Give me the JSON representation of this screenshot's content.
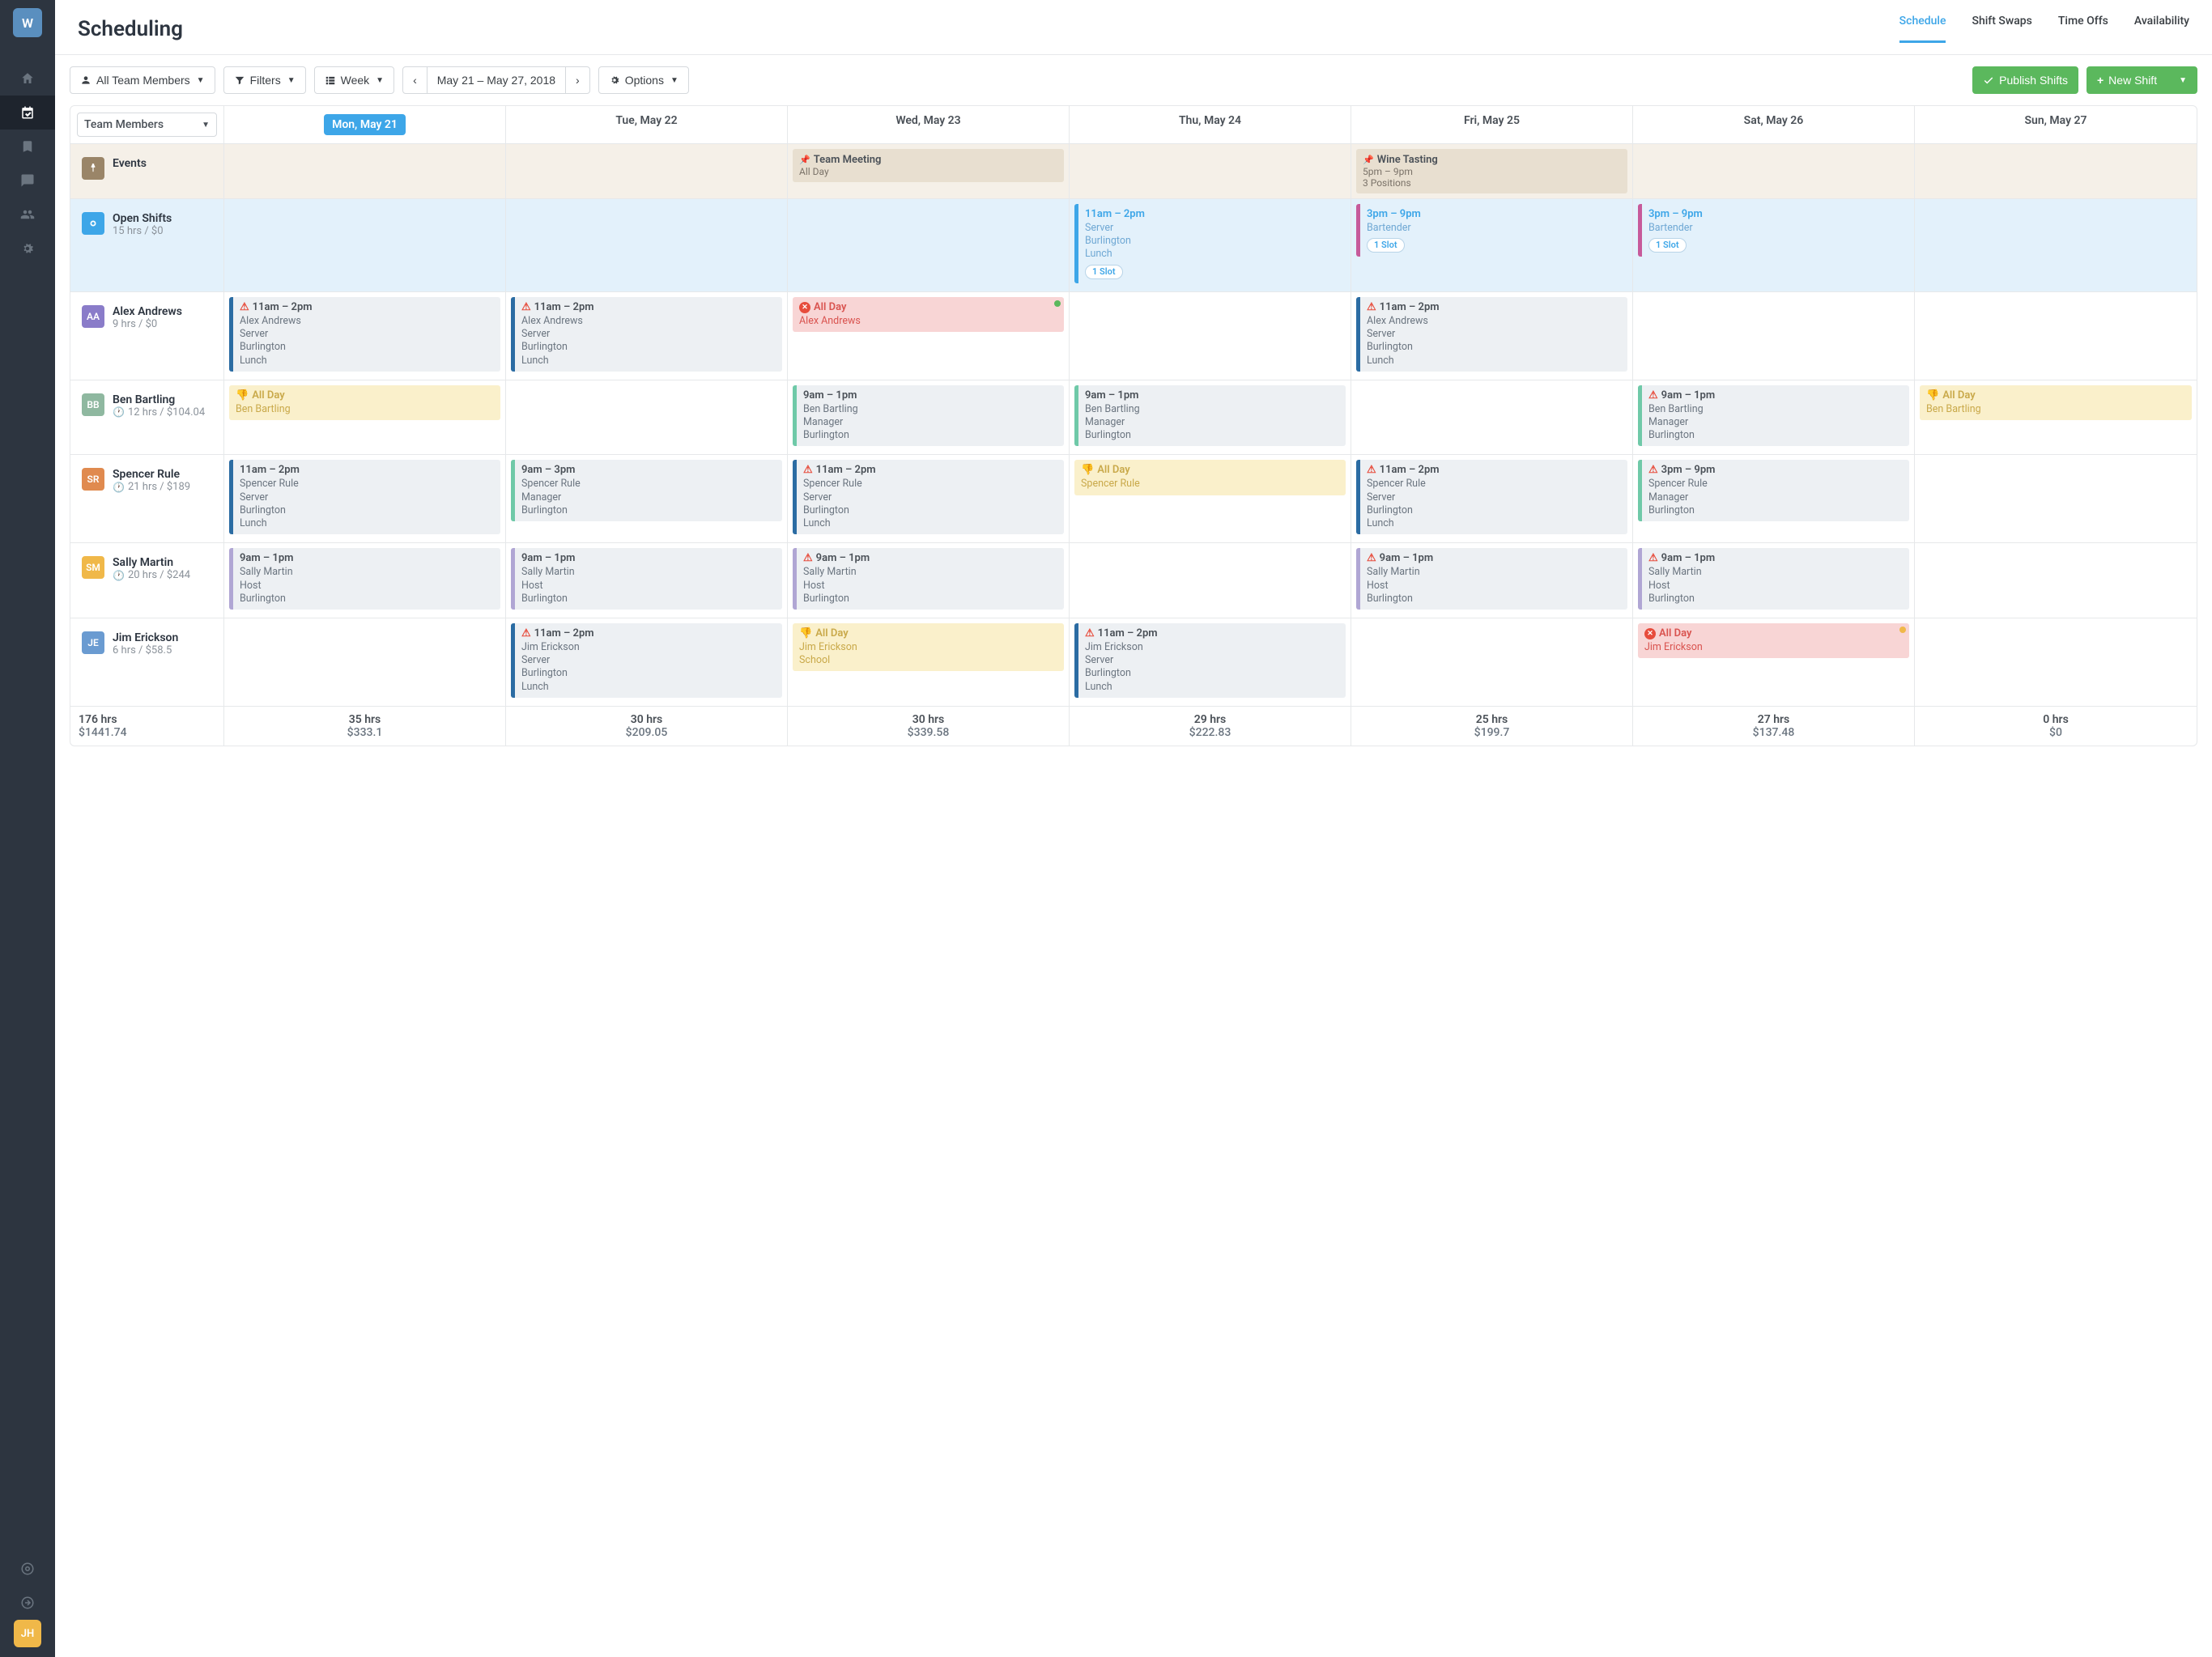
{
  "sidebar": {
    "logo": "W",
    "user_avatar": "JH"
  },
  "header": {
    "title": "Scheduling",
    "tabs": [
      {
        "label": "Schedule",
        "active": true
      },
      {
        "label": "Shift Swaps",
        "active": false
      },
      {
        "label": "Time Offs",
        "active": false
      },
      {
        "label": "Availability",
        "active": false
      }
    ]
  },
  "toolbar": {
    "team_filter": "All Team Members",
    "filters": "Filters",
    "view": "Week",
    "date_range": "May 21 – May 27, 2018",
    "options": "Options",
    "publish": "Publish Shifts",
    "new_shift": "New Shift"
  },
  "columns": {
    "selector": "Team Members",
    "days": [
      "Mon, May 21",
      "Tue, May 22",
      "Wed, May 23",
      "Thu, May 24",
      "Fri, May 25",
      "Sat, May 26",
      "Sun, May 27"
    ]
  },
  "events_row": {
    "label": "Events",
    "items": {
      "wed": {
        "title": "Team Meeting",
        "sub": "All Day"
      },
      "fri": {
        "title": "Wine Tasting",
        "sub1": "5pm – 9pm",
        "sub2": "3 Positions"
      }
    }
  },
  "open_shifts": {
    "label": "Open Shifts",
    "meta": "15 hrs / $0",
    "thu": {
      "time": "11am – 2pm",
      "role": "Server",
      "loc": "Burlington",
      "period": "Lunch",
      "slot": "1 Slot",
      "bar": "#3da6e8"
    },
    "fri": {
      "time": "3pm – 9pm",
      "role": "Bartender",
      "slot": "1 Slot",
      "bar": "#c75a9a"
    },
    "sat": {
      "time": "3pm – 9pm",
      "role": "Bartender",
      "slot": "1 Slot",
      "bar": "#c75a9a"
    }
  },
  "members": [
    {
      "initials": "AA",
      "color": "#8a7cc9",
      "name": "Alex Andrews",
      "meta": "9 hrs / $0",
      "clock": false,
      "shifts": {
        "mon": {
          "type": "std",
          "alert": true,
          "time": "11am – 2pm",
          "l1": "Alex Andrews",
          "l2": "Server",
          "l3": "Burlington",
          "l4": "Lunch",
          "bar": "#2b6ca3"
        },
        "tue": {
          "type": "std",
          "alert": true,
          "time": "11am – 2pm",
          "l1": "Alex Andrews",
          "l2": "Server",
          "l3": "Burlington",
          "l4": "Lunch",
          "bar": "#2b6ca3"
        },
        "wed": {
          "type": "red",
          "xicon": true,
          "time": "All Day",
          "l1": "Alex Andrews",
          "dot": "#5bb85d"
        },
        "fri": {
          "type": "std",
          "alert": true,
          "time": "11am – 2pm",
          "l1": "Alex Andrews",
          "l2": "Server",
          "l3": "Burlington",
          "l4": "Lunch",
          "bar": "#2b6ca3"
        }
      }
    },
    {
      "initials": "BB",
      "color": "#8fb8a0",
      "name": "Ben Bartling",
      "meta": "12 hrs / $104.04",
      "clock": true,
      "shifts": {
        "mon": {
          "type": "yellow",
          "thumb": true,
          "time": "All Day",
          "l1": "Ben Bartling"
        },
        "wed": {
          "type": "std",
          "time": "9am – 1pm",
          "l1": "Ben Bartling",
          "l2": "Manager",
          "l3": "Burlington",
          "bar": "#6fc9a8"
        },
        "thu": {
          "type": "std",
          "time": "9am – 1pm",
          "l1": "Ben Bartling",
          "l2": "Manager",
          "l3": "Burlington",
          "bar": "#6fc9a8"
        },
        "sat": {
          "type": "std",
          "alert": true,
          "time": "9am – 1pm",
          "l1": "Ben Bartling",
          "l2": "Manager",
          "l3": "Burlington",
          "bar": "#6fc9a8"
        },
        "sun": {
          "type": "yellow",
          "thumb": true,
          "time": "All Day",
          "l1": "Ben Bartling"
        }
      }
    },
    {
      "initials": "SR",
      "color": "#e08a4f",
      "name": "Spencer Rule",
      "meta": "21 hrs / $189",
      "clock": true,
      "shifts": {
        "mon": {
          "type": "std",
          "time": "11am – 2pm",
          "l1": "Spencer Rule",
          "l2": "Server",
          "l3": "Burlington",
          "l4": "Lunch",
          "bar": "#2b6ca3"
        },
        "tue": {
          "type": "std",
          "time": "9am – 3pm",
          "l1": "Spencer Rule",
          "l2": "Manager",
          "l3": "Burlington",
          "bar": "#6fc9a8"
        },
        "wed": {
          "type": "std",
          "alert": true,
          "time": "11am – 2pm",
          "l1": "Spencer Rule",
          "l2": "Server",
          "l3": "Burlington",
          "l4": "Lunch",
          "bar": "#2b6ca3"
        },
        "thu": {
          "type": "yellow",
          "thumb": true,
          "time": "All Day",
          "l1": "Spencer Rule"
        },
        "fri": {
          "type": "std",
          "alert": true,
          "time": "11am – 2pm",
          "l1": "Spencer Rule",
          "l2": "Server",
          "l3": "Burlington",
          "l4": "Lunch",
          "bar": "#2b6ca3"
        },
        "sat": {
          "type": "std",
          "alert": true,
          "time": "3pm – 9pm",
          "l1": "Spencer Rule",
          "l2": "Manager",
          "l3": "Burlington",
          "bar": "#6fc9a8"
        }
      }
    },
    {
      "initials": "SM",
      "color": "#f0b849",
      "name": "Sally Martin",
      "meta": "20 hrs / $244",
      "clock": true,
      "shifts": {
        "mon": {
          "type": "std",
          "time": "9am – 1pm",
          "l1": "Sally Martin",
          "l2": "Host",
          "l3": "Burlington",
          "bar": "#b0a6d4"
        },
        "tue": {
          "type": "std",
          "time": "9am – 1pm",
          "l1": "Sally Martin",
          "l2": "Host",
          "l3": "Burlington",
          "bar": "#b0a6d4"
        },
        "wed": {
          "type": "std",
          "alert": true,
          "time": "9am – 1pm",
          "l1": "Sally Martin",
          "l2": "Host",
          "l3": "Burlington",
          "bar": "#b0a6d4"
        },
        "fri": {
          "type": "std",
          "alert": true,
          "time": "9am – 1pm",
          "l1": "Sally Martin",
          "l2": "Host",
          "l3": "Burlington",
          "bar": "#b0a6d4"
        },
        "sat": {
          "type": "std",
          "alert": true,
          "time": "9am – 1pm",
          "l1": "Sally Martin",
          "l2": "Host",
          "l3": "Burlington",
          "bar": "#b0a6d4"
        }
      }
    },
    {
      "initials": "JE",
      "color": "#6a9bd1",
      "name": "Jim Erickson",
      "meta": "6 hrs / $58.5",
      "clock": false,
      "shifts": {
        "tue": {
          "type": "std",
          "alert": true,
          "time": "11am – 2pm",
          "l1": "Jim Erickson",
          "l2": "Server",
          "l3": "Burlington",
          "l4": "Lunch",
          "bar": "#2b6ca3"
        },
        "wed": {
          "type": "yellow",
          "thumb": true,
          "time": "All Day",
          "l1": "Jim Erickson",
          "l2": "School"
        },
        "thu": {
          "type": "std",
          "alert": true,
          "time": "11am – 2pm",
          "l1": "Jim Erickson",
          "l2": "Server",
          "l3": "Burlington",
          "l4": "Lunch",
          "bar": "#2b6ca3"
        },
        "sat": {
          "type": "red",
          "xicon": true,
          "time": "All Day",
          "l1": "Jim Erickson",
          "dot": "#f0b849"
        }
      }
    }
  ],
  "footer": {
    "total": {
      "hrs": "176 hrs",
      "amt": "$1441.74"
    },
    "days": [
      {
        "hrs": "35 hrs",
        "amt": "$333.1"
      },
      {
        "hrs": "30 hrs",
        "amt": "$209.05"
      },
      {
        "hrs": "30 hrs",
        "amt": "$339.58"
      },
      {
        "hrs": "29 hrs",
        "amt": "$222.83"
      },
      {
        "hrs": "25 hrs",
        "amt": "$199.7"
      },
      {
        "hrs": "27 hrs",
        "amt": "$137.48"
      },
      {
        "hrs": "0 hrs",
        "amt": "$0"
      }
    ]
  }
}
